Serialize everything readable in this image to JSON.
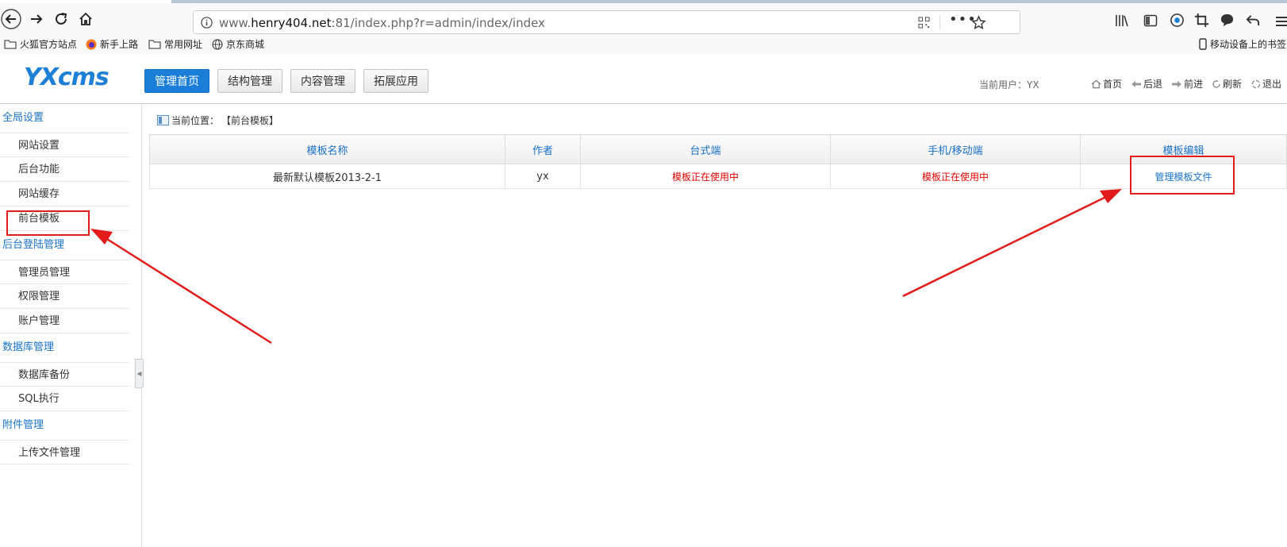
{
  "browser": {
    "url_prefix": "www.",
    "url_host": "henry404.net",
    "url_rest": ":81/index.php?r=admin/index/index",
    "bookmarks": [
      "火狐官方站点",
      "新手上路",
      "常用网址",
      "京东商城"
    ],
    "mobile_bookmarks": "移动设备上的书签"
  },
  "header": {
    "logo": "YXcms",
    "tabs": [
      "管理首页",
      "结构管理",
      "内容管理",
      "拓展应用"
    ],
    "active_tab": 0,
    "current_user": "当前用户：YX",
    "links": [
      "首页",
      "后退",
      "前进",
      "刷新",
      "退出"
    ]
  },
  "sidebar": {
    "groups": [
      {
        "label": "全局设置",
        "items": [
          "网站设置",
          "后台功能",
          "网站缓存",
          "前台模板"
        ]
      },
      {
        "label": "后台登陆管理",
        "items": [
          "管理员管理",
          "权限管理",
          "账户管理"
        ]
      },
      {
        "label": "数据库管理",
        "items": [
          "数据库备份",
          "SQL执行"
        ]
      },
      {
        "label": "附件管理",
        "items": [
          "上传文件管理"
        ]
      }
    ],
    "highlighted": "前台模板"
  },
  "main": {
    "breadcrumb_label": "当前位置：",
    "breadcrumb_value": "【前台模板】",
    "table": {
      "columns": [
        "模板名称",
        "作者",
        "台式端",
        "手机/移动端",
        "模板编辑"
      ],
      "rows": [
        {
          "name": "最新默认模板2013-2-1",
          "author": "yx",
          "desktop": "模板正在使用中",
          "mobile": "模板正在使用中",
          "edit": "管理模板文件"
        }
      ]
    }
  },
  "colors": {
    "accent": "#1b7fd9",
    "link": "#1a72c9",
    "in_use": "#e60000",
    "annotation": "#e21b1b"
  }
}
